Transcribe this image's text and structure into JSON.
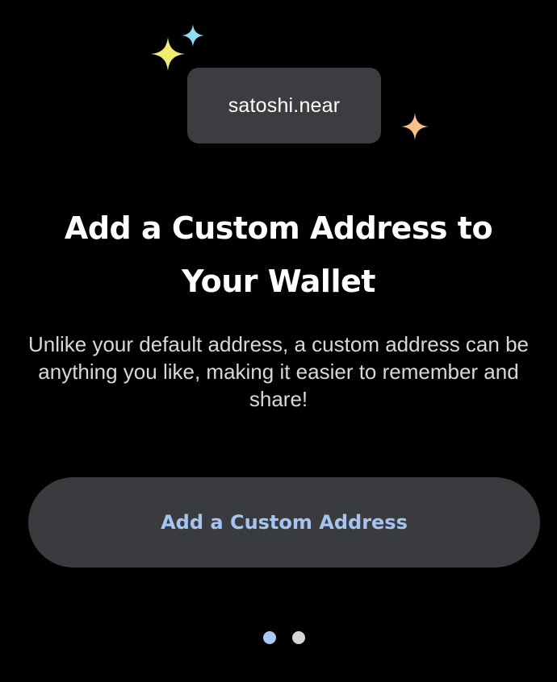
{
  "onboarding": {
    "address_example": "satoshi.near",
    "title": "Add a Custom Address to Your Wallet",
    "description": "Unlike your default address, a custom address can be anything you like, making it easier to remember and share!",
    "cta_label": "Add a Custom Address"
  },
  "pager": {
    "total_pages": 2,
    "current_page": 1
  },
  "decorations": {
    "sparkles": [
      {
        "icon": "sparkle-icon",
        "color": "#f4ec70"
      },
      {
        "icon": "sparkle-icon",
        "color": "#8fdcf6"
      },
      {
        "icon": "sparkle-icon",
        "color": "#f6c08c"
      }
    ]
  },
  "colors": {
    "background": "#000000",
    "chip_background": "#3c3d41",
    "button_background": "#3a3b3f",
    "accent": "#a6c4f2",
    "dot_active": "#a9c8f2",
    "dot_inactive": "#d6d6da"
  }
}
